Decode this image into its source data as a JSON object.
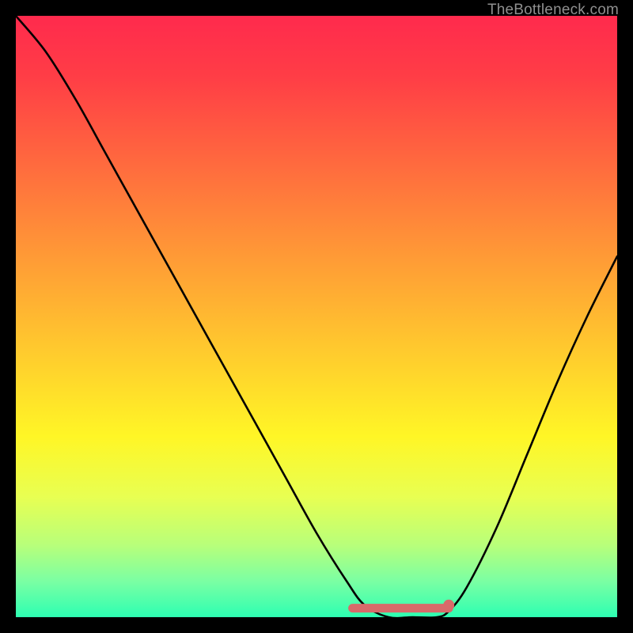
{
  "attribution": "TheBottleneck.com",
  "chart_data": {
    "type": "line",
    "title": "",
    "xlabel": "",
    "ylabel": "",
    "xlim": [
      0,
      100
    ],
    "ylim": [
      0,
      100
    ],
    "grid": false,
    "legend": false,
    "background": "red-yellow-green vertical gradient",
    "series": [
      {
        "name": "bottleneck-curve",
        "color": "#000000",
        "x": [
          0,
          5,
          10,
          15,
          20,
          25,
          30,
          35,
          40,
          45,
          50,
          55,
          58,
          62,
          66,
          70,
          72,
          75,
          80,
          85,
          90,
          95,
          100
        ],
        "y": [
          100,
          94,
          86,
          77,
          68,
          59,
          50,
          41,
          32,
          23,
          14,
          6,
          2,
          0,
          0,
          0,
          1,
          5,
          15,
          27,
          39,
          50,
          60
        ]
      },
      {
        "name": "highlight-band",
        "color": "#d86a6a",
        "x": [
          56,
          72
        ],
        "y": [
          1.5,
          1.5
        ]
      }
    ],
    "markers": [
      {
        "name": "highlight-dot",
        "x": 72,
        "y": 2,
        "color": "#d86a6a"
      }
    ]
  }
}
